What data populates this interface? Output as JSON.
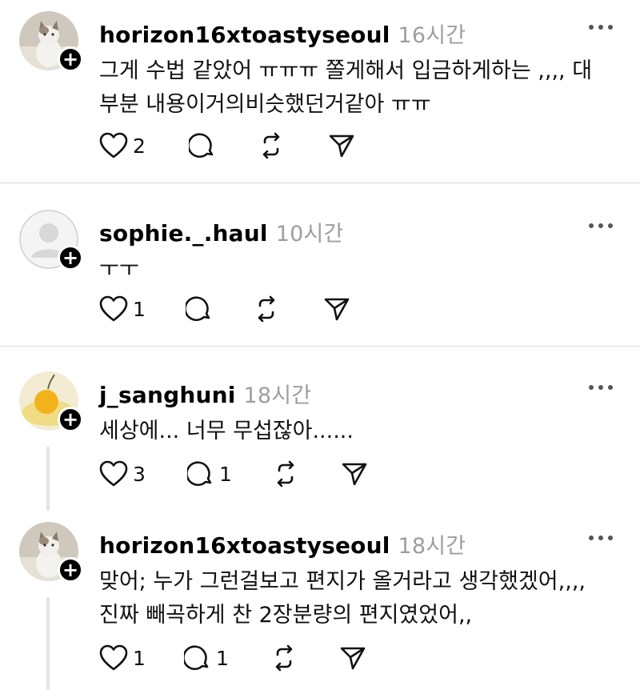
{
  "posts": [
    {
      "username": "horizon16xtoastyseoul",
      "time": "16시간",
      "text": "그게 수법 같았어 ㅠㅠㅠ 쫄게해서 입금하게하는 ,,,, 대\n부분 내용이거의비슷했던거같아 ㅠㅠ",
      "likes": "2",
      "replies": "",
      "avatar": "cat-photo"
    },
    {
      "username": "sophie._.haul",
      "time": "10시간",
      "text": "ㅜㅜ",
      "likes": "1",
      "replies": "",
      "avatar": "default-person"
    },
    {
      "username": "j_sanghuni",
      "time": "18시간",
      "text": "세상에... 너무 무섭잖아......",
      "likes": "3",
      "replies": "1",
      "avatar": "orange-photo"
    },
    {
      "username": "horizon16xtoastyseoul",
      "time": "18시간",
      "text": "맞어; 누가 그런걸보고 편지가 올거라고 생각했겠어,,,,\n진짜 빼곡하게 찬 2장분량의 편지였었어,,",
      "likes": "1",
      "replies": "1",
      "avatar": "cat-photo"
    }
  ],
  "icons": {
    "like": "heart-icon",
    "reply": "comment-icon",
    "repost": "repost-icon",
    "share": "send-icon",
    "more": "more-icon",
    "follow": "plus-icon"
  }
}
